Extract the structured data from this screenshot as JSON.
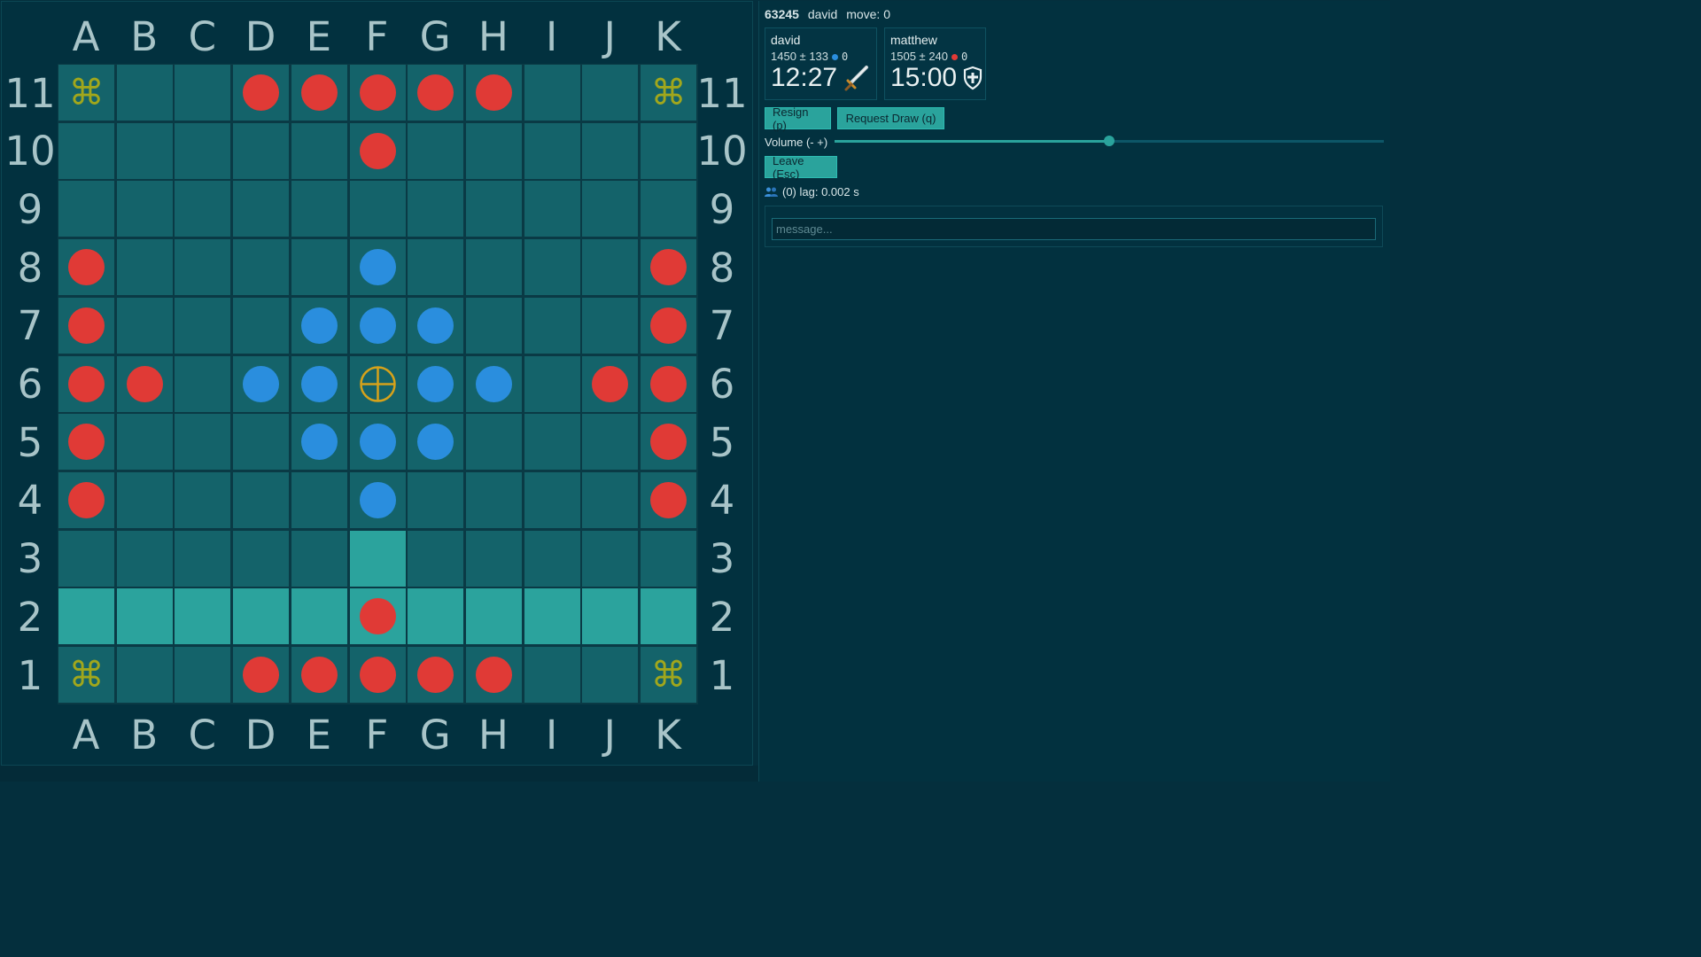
{
  "board": {
    "columns": [
      "A",
      "B",
      "C",
      "D",
      "E",
      "F",
      "G",
      "H",
      "I",
      "J",
      "K"
    ],
    "rows": [
      "11",
      "10",
      "9",
      "8",
      "7",
      "6",
      "5",
      "4",
      "3",
      "2",
      "1"
    ],
    "pieces": [
      {
        "color": "red",
        "col": "D",
        "row": "11"
      },
      {
        "color": "red",
        "col": "E",
        "row": "11"
      },
      {
        "color": "red",
        "col": "F",
        "row": "11"
      },
      {
        "color": "red",
        "col": "G",
        "row": "11"
      },
      {
        "color": "red",
        "col": "H",
        "row": "11"
      },
      {
        "color": "red",
        "col": "F",
        "row": "10"
      },
      {
        "color": "red",
        "col": "A",
        "row": "8"
      },
      {
        "color": "blue",
        "col": "F",
        "row": "8"
      },
      {
        "color": "red",
        "col": "K",
        "row": "8"
      },
      {
        "color": "red",
        "col": "A",
        "row": "7"
      },
      {
        "color": "blue",
        "col": "E",
        "row": "7"
      },
      {
        "color": "blue",
        "col": "F",
        "row": "7"
      },
      {
        "color": "blue",
        "col": "G",
        "row": "7"
      },
      {
        "color": "red",
        "col": "K",
        "row": "7"
      },
      {
        "color": "red",
        "col": "A",
        "row": "6"
      },
      {
        "color": "red",
        "col": "B",
        "row": "6"
      },
      {
        "color": "blue",
        "col": "D",
        "row": "6"
      },
      {
        "color": "blue",
        "col": "E",
        "row": "6"
      },
      {
        "color": "blue",
        "col": "G",
        "row": "6"
      },
      {
        "color": "blue",
        "col": "H",
        "row": "6"
      },
      {
        "color": "red",
        "col": "J",
        "row": "6"
      },
      {
        "color": "red",
        "col": "K",
        "row": "6"
      },
      {
        "color": "red",
        "col": "A",
        "row": "5"
      },
      {
        "color": "blue",
        "col": "E",
        "row": "5"
      },
      {
        "color": "blue",
        "col": "F",
        "row": "5"
      },
      {
        "color": "blue",
        "col": "G",
        "row": "5"
      },
      {
        "color": "red",
        "col": "K",
        "row": "5"
      },
      {
        "color": "red",
        "col": "A",
        "row": "4"
      },
      {
        "color": "blue",
        "col": "F",
        "row": "4"
      },
      {
        "color": "red",
        "col": "K",
        "row": "4"
      },
      {
        "color": "red",
        "col": "F",
        "row": "2"
      },
      {
        "color": "red",
        "col": "D",
        "row": "1"
      },
      {
        "color": "red",
        "col": "E",
        "row": "1"
      },
      {
        "color": "red",
        "col": "F",
        "row": "1"
      },
      {
        "color": "red",
        "col": "G",
        "row": "1"
      },
      {
        "color": "red",
        "col": "H",
        "row": "1"
      }
    ],
    "king": {
      "col": "F",
      "row": "6",
      "icon": "king-crosshair-icon"
    },
    "corners": [
      {
        "col": "A",
        "row": "11",
        "symbol": "⌘"
      },
      {
        "col": "K",
        "row": "11",
        "symbol": "⌘"
      },
      {
        "col": "A",
        "row": "1",
        "symbol": "⌘"
      },
      {
        "col": "K",
        "row": "1",
        "symbol": "⌘"
      }
    ],
    "highlighted": [
      {
        "col": "F",
        "row": "3"
      },
      {
        "col": "A",
        "row": "2"
      },
      {
        "col": "B",
        "row": "2"
      },
      {
        "col": "C",
        "row": "2"
      },
      {
        "col": "D",
        "row": "2"
      },
      {
        "col": "E",
        "row": "2"
      },
      {
        "col": "F",
        "row": "2"
      },
      {
        "col": "G",
        "row": "2"
      },
      {
        "col": "H",
        "row": "2"
      },
      {
        "col": "I",
        "row": "2"
      },
      {
        "col": "J",
        "row": "2"
      },
      {
        "col": "K",
        "row": "2"
      }
    ],
    "colors": {
      "red": "#e03a36",
      "blue": "#2a8ede",
      "cell": "#14636a",
      "highlight": "#2ba39d",
      "corner": "#a1a71c",
      "king": "#d6a21a"
    }
  },
  "game": {
    "id": "63245",
    "player": "david",
    "move_text": "move: 0"
  },
  "players": [
    {
      "name": "david",
      "rating": "1450",
      "pm": "±",
      "deviation": "133",
      "dot_color": "#2a8ede",
      "captures": "0",
      "clock": "12:27",
      "role_icon": "sword-icon"
    },
    {
      "name": "matthew",
      "rating": "1505",
      "pm": "±",
      "deviation": "240",
      "dot_color": "#e03a36",
      "captures": "0",
      "clock": "15:00",
      "role_icon": "shield-icon"
    }
  ],
  "controls": {
    "resign": "Resign (p)",
    "draw": "Request Draw (q)",
    "volume_label": "Volume (- +)",
    "volume_level": 0.5,
    "leave": "Leave (Esc)"
  },
  "spectators": {
    "icon": "people-icon",
    "text": "(0) lag: 0.002 s"
  },
  "chat": {
    "placeholder": "message..."
  }
}
